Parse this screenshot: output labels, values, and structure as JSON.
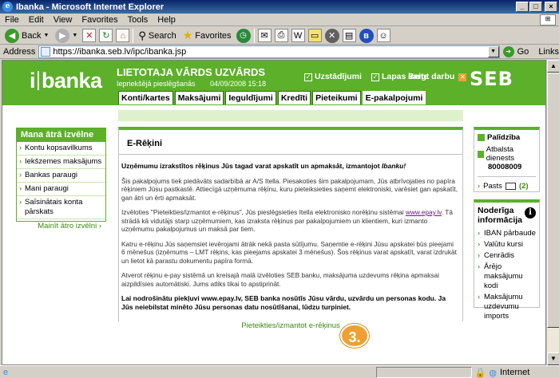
{
  "window": {
    "title": "Ibanka - Microsoft Internet Explorer",
    "buttons": {
      "minimize": "_",
      "maximize": "□",
      "close": "×"
    }
  },
  "menu": [
    "File",
    "Edit",
    "View",
    "Favorites",
    "Tools",
    "Help"
  ],
  "toolbar": {
    "back": "Back",
    "search": "Search",
    "favorites": "Favorites"
  },
  "address": {
    "label": "Address",
    "url": "https://ibanka.seb.lv/ipc/ibanka.jsp",
    "go": "Go",
    "links": "Links"
  },
  "bank": {
    "logo_i": "i",
    "logo_rest": "banka",
    "user_name": "LIETOTAJA VĀRDS UZVĀRDS",
    "last_login_label": "Iepriekšējā pieslēgšanās",
    "last_login_date": "04/09/2008 15:18",
    "settings": "Uzstādījumi",
    "sitemap": "Lapas karte",
    "logout": "Beigt darbu",
    "brand": "SEB"
  },
  "tabs": [
    {
      "label": "Konti/kartes",
      "active": false
    },
    {
      "label": "Maksājumi",
      "active": false
    },
    {
      "label": "Ieguldījumi",
      "active": false
    },
    {
      "label": "Kredīti",
      "active": false
    },
    {
      "label": "Pieteikumi",
      "active": false
    },
    {
      "label": "E-pakalpojumi",
      "active": true
    }
  ],
  "quick": {
    "title": "Mana ātrā izvēlne",
    "items": [
      "Kontu kopsavilkums",
      "Iekšzemes maksājums",
      "Bankas paraugi",
      "Mani paraugi",
      "Saīsinātais konta pārskats"
    ],
    "change": "Mainīt ātro izvēlni ›"
  },
  "main": {
    "title": "E-Rēķini",
    "lead": "Uzņēmumu izrakstītos rēķinus Jūs tagad varat apskatīt un apmaksāt, izmantojot ",
    "lead_brand": "Ibanku!",
    "p1": "Šis pakalpojums tiek piedāvāts sadarbībā ar A/S Itella. Piesakoties šim pakalpojumam, Jūs atbrīvojaties no papīra rēķiniem Jūsu pastkastē. Attiecīgā uzņēmuma rēķinu, kuru pieteiksieties saņemt elektroniski, varēsiet gan apskatīt, gan ātri un ērti apmaksāt.",
    "p2a": "Izvēloties \"Pieteikties/izmantot e-rēķinus\", Jūs pieslēgsieties Itella elektronisko norēķinu sistēmai ",
    "p2_link": "www.epay.lv",
    "p2b": ". Tā strādā kā vidutājs starp uzņēmumiem, kas izraksta rēķinus par pakalpojumiem un klientiem, kuri izmanto uzņēmumu pakalpojumus un maksā par tiem.",
    "p3": "Katru e-rēķinu Jūs saņemsiet ievērojami ātrāk nekā pasta sūtījumu. Saņemtie e-rēķini Jūsu apskatei būs pieejami 6 mēnešus (izņēmums – LMT rēķins, kas pieejams apskatei 3 mēnešus). Šos rēķinus varat apskatīt, varat izdrukāt un lietot kā parastu dokumentu papīra formā.",
    "p4": "Atverot rēķinu e-pay sistēmā un kreisajā malā izvēloties SEB banku, maksājuma uzdevums rēķina apmaksai aizpildīsies automātiski. Jums atliks tikai to apstiprināt.",
    "p5": "Lai nodrošinātu piekļuvi www.epay.lv, SEB banka nosūtīs Jūsu vārdu, uzvārdu un personas kodu. Ja Jūs neiebilstat minēto Jūsu personas datu nosūtīšanai, lūdzu turpiniet.",
    "footer_link": "Pieteikties/izmantot e-rēķinus",
    "badge": "3."
  },
  "help": {
    "title": "Palīdzība",
    "service_label": "Atbalsta dienests",
    "phone": "80008009",
    "posts_label": "Pasts",
    "posts_count": "(2)"
  },
  "info": {
    "title": "Noderīga informācija",
    "i": "i",
    "items": [
      "IBAN pārbaude",
      "Valūtu kursi",
      "Cenrādis",
      "Ārējo maksājumu kodi",
      "Maksājumu uzdevumu imports"
    ]
  },
  "status": {
    "zone": "Internet"
  }
}
